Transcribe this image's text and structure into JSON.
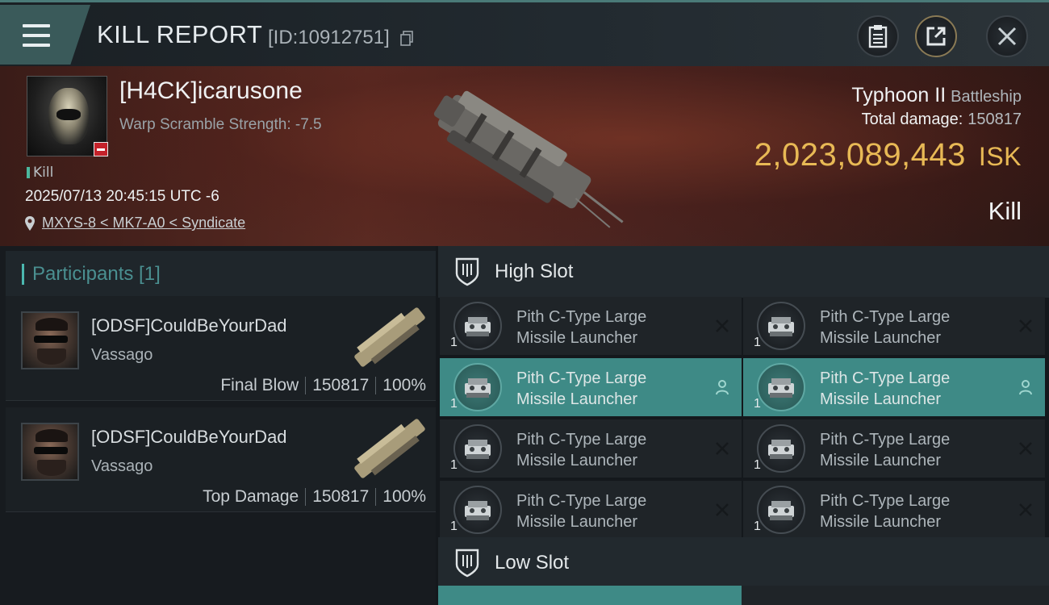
{
  "header": {
    "title": "KILL REPORT",
    "report_id": "[ID:10912751]"
  },
  "victim": {
    "name": "[H4CK]icarusone",
    "warp_scramble": "Warp Scramble Strength: -7.5",
    "kill_tag": "Kill",
    "datetime": "2025/07/13 20:45:15 UTC -6",
    "location": "MXYS-8 < MK7-A0 < Syndicate",
    "ship_name": "Typhoon II",
    "ship_class": "Battleship",
    "total_damage_label": "Total damage:",
    "total_damage": "150817",
    "isk_value": "2,023,089,443",
    "isk_unit": "ISK",
    "result": "Kill"
  },
  "participants": {
    "header": "Participants [1]",
    "items": [
      {
        "name": "[ODSF]CouldBeYourDad",
        "ship": "Vassago",
        "role": "Final Blow",
        "damage": "150817",
        "percent": "100%"
      },
      {
        "name": "[ODSF]CouldBeYourDad",
        "ship": "Vassago",
        "role": "Top Damage",
        "damage": "150817",
        "percent": "100%"
      }
    ]
  },
  "slots": {
    "high_label": "High Slot",
    "low_label": "Low Slot",
    "modules": [
      {
        "line1": "Pith C-Type Large",
        "line2": "Missile Launcher",
        "qty": "1",
        "status": "destroyed"
      },
      {
        "line1": "Pith C-Type Large",
        "line2": "Missile Launcher",
        "qty": "1",
        "status": "destroyed"
      },
      {
        "line1": "Pith C-Type Large",
        "line2": "Missile Launcher",
        "qty": "1",
        "status": "dropped"
      },
      {
        "line1": "Pith C-Type Large",
        "line2": "Missile Launcher",
        "qty": "1",
        "status": "dropped"
      },
      {
        "line1": "Pith C-Type Large",
        "line2": "Missile Launcher",
        "qty": "1",
        "status": "destroyed"
      },
      {
        "line1": "Pith C-Type Large",
        "line2": "Missile Launcher",
        "qty": "1",
        "status": "destroyed"
      },
      {
        "line1": "Pith C-Type Large",
        "line2": "Missile Launcher",
        "qty": "1",
        "status": "destroyed"
      },
      {
        "line1": "Pith C-Type Large",
        "line2": "Missile Launcher",
        "qty": "1",
        "status": "destroyed"
      }
    ]
  },
  "colors": {
    "accent_teal": "#3e8a86",
    "isk_gold": "#e8b955",
    "badge_red": "#c4222a"
  },
  "icons": [
    "menu-icon",
    "copy-icon",
    "clipboard-icon",
    "share-icon",
    "close-icon",
    "location-pin-icon",
    "shield-slot-icon",
    "destroyed-x-icon",
    "person-icon",
    "missile-launcher-icon"
  ]
}
